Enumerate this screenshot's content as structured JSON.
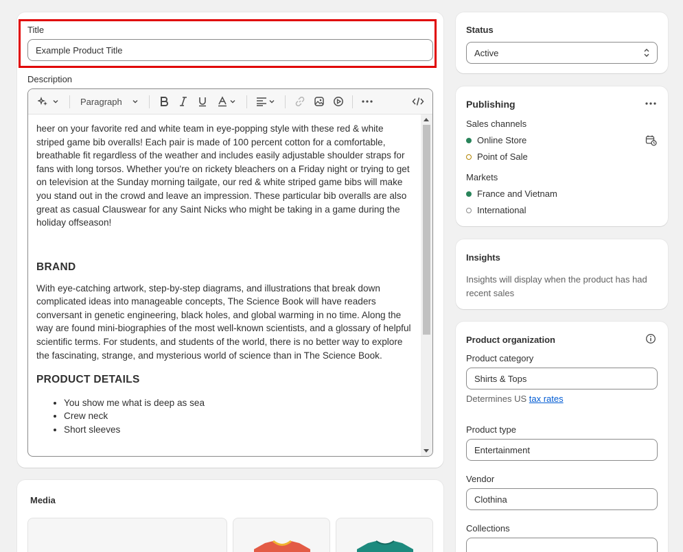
{
  "title": {
    "label": "Title",
    "value": "Example Product Title"
  },
  "description": {
    "label": "Description",
    "toolbar": {
      "paragraph_label": "Paragraph"
    },
    "paragraphs": [
      "heer on your favorite red and white team in eye-popping style with these red & white striped game bib overalls! Each pair is made of 100 percent cotton for a comfortable, breathable fit regardless of the weather and includes easily adjustable shoulder straps for fans with long torsos. Whether you're on rickety bleachers on a Friday night or trying to get on television at the Sunday morning tailgate, our red & white striped game bibs will make you stand out in the crowd and leave an impression. These particular bib overalls are also great as casual Clauswear for any Saint Nicks who might be taking in a game during the holiday offseason!"
    ],
    "brand_heading": "BRAND",
    "brand_text": "With eye-catching artwork, step-by-step diagrams, and illustrations that break down complicated ideas into manageable concepts, The Science Book will have readers conversant in genetic engineering, black holes, and global warming in no time. Along the way are found mini-biographies of the most well-known scientists, and a glossary of helpful scientific terms. For students, and students of the world, there is no better way to explore the fascinating, strange, and mysterious world of science than in The Science Book.",
    "details_heading": "PRODUCT DETAILS",
    "details": [
      "You show me what is deep as sea",
      "Crew neck",
      "Short sleeves"
    ]
  },
  "media": {
    "title": "Media"
  },
  "status": {
    "title": "Status",
    "value": "Active"
  },
  "publishing": {
    "title": "Publishing",
    "sales_channels_label": "Sales channels",
    "channels": [
      {
        "name": "Online Store",
        "state": "active"
      },
      {
        "name": "Point of Sale",
        "state": "pending"
      }
    ],
    "markets_label": "Markets",
    "markets": [
      {
        "name": "France and Vietnam",
        "state": "active"
      },
      {
        "name": "International",
        "state": "inactive"
      }
    ]
  },
  "insights": {
    "title": "Insights",
    "text": "Insights will display when the product has had recent sales"
  },
  "organization": {
    "title": "Product organization",
    "category_label": "Product category",
    "category_value": "Shirts & Tops",
    "category_help_prefix": "Determines US ",
    "category_help_link": "tax rates",
    "type_label": "Product type",
    "type_value": "Entertainment",
    "vendor_label": "Vendor",
    "vendor_value": "Clothina",
    "collections_label": "Collections"
  },
  "colors": {
    "active_dot": "#29845a",
    "pending_dot": "#b28400",
    "highlight": "#e00000",
    "link": "#005bd3",
    "shirt_red": "#e35b45",
    "shirt_teal": "#1d8a7e"
  }
}
